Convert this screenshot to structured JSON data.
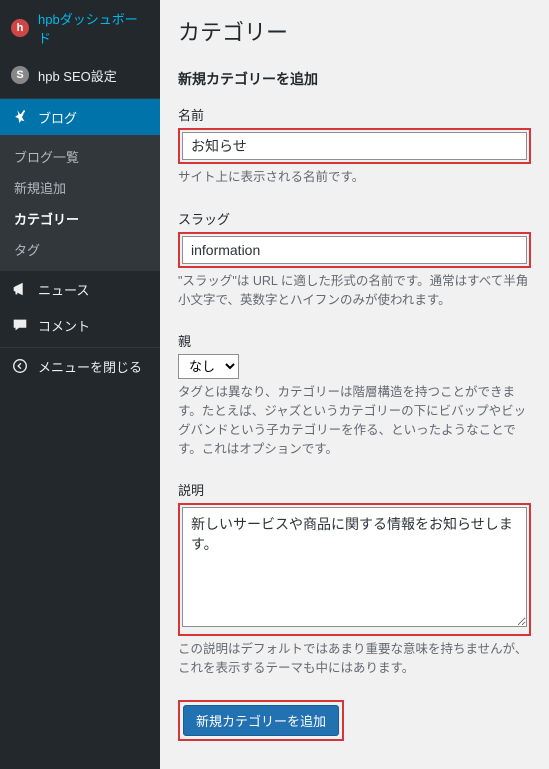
{
  "sidebar": {
    "top": [
      {
        "label": "hpbダッシュボード",
        "icon": "h"
      },
      {
        "label": "hpb SEO設定",
        "icon": "s"
      }
    ],
    "blog": {
      "label": "ブログ",
      "submenu": [
        {
          "label": "ブログ一覧"
        },
        {
          "label": "新規追加"
        },
        {
          "label": "カテゴリー",
          "current": true
        },
        {
          "label": "タグ"
        }
      ]
    },
    "items": [
      {
        "label": "ニュース",
        "icon": "megaphone"
      },
      {
        "label": "コメント",
        "icon": "comment"
      },
      {
        "label": "メニューを閉じる",
        "icon": "collapse"
      }
    ]
  },
  "page": {
    "title": "カテゴリー",
    "subtitle": "新規カテゴリーを追加",
    "fields": {
      "name": {
        "label": "名前",
        "value": "お知らせ",
        "help": "サイト上に表示される名前です。"
      },
      "slug": {
        "label": "スラッグ",
        "value": "information",
        "help": "\"スラッグ\"は URL に適した形式の名前です。通常はすべて半角小文字で、英数字とハイフンのみが使われます。"
      },
      "parent": {
        "label": "親",
        "selected": "なし",
        "help": "タグとは異なり、カテゴリーは階層構造を持つことができます。たとえば、ジャズというカテゴリーの下にビバップやビッグバンドという子カテゴリーを作る、といったようなことです。これはオプションです。"
      },
      "description": {
        "label": "説明",
        "value": "新しいサービスや商品に関する情報をお知らせします。",
        "help": "この説明はデフォルトではあまり重要な意味を持ちませんが、これを表示するテーマも中にはあります。"
      }
    },
    "submit": "新規カテゴリーを追加"
  }
}
